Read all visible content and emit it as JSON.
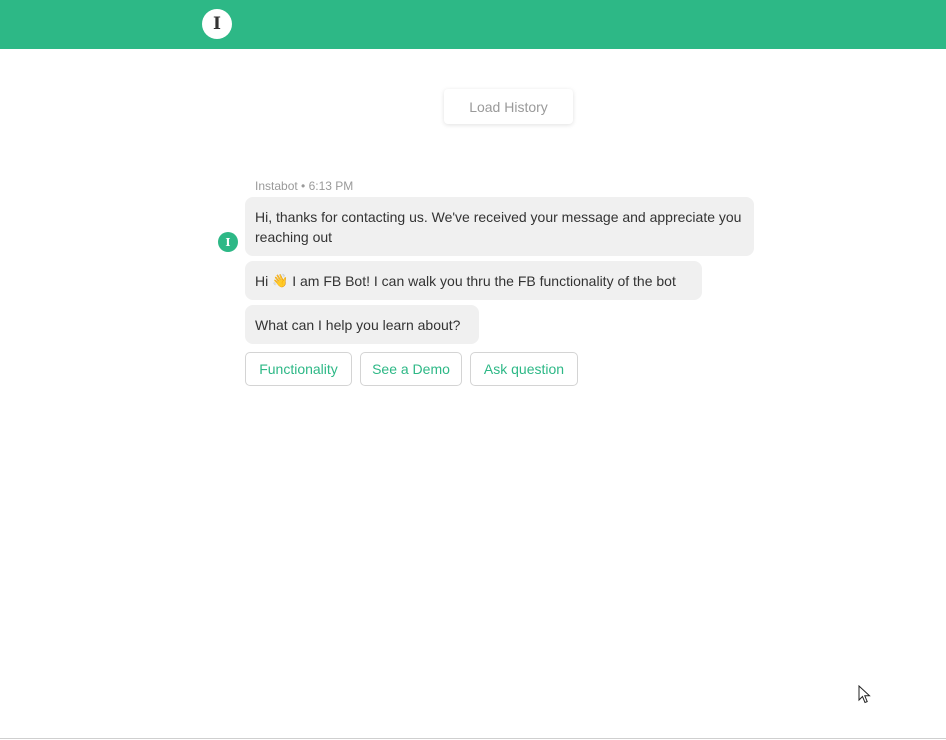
{
  "header": {
    "logo_letter": "I",
    "brand_color": "#2db886"
  },
  "chat": {
    "load_history_label": "Load History",
    "sender_meta": "Instabot • 6:13 PM",
    "bot_avatar_letter": "I",
    "messages": [
      {
        "text": "Hi, thanks for contacting us. We've received your message and appreciate you reaching out"
      },
      {
        "prefix": "Hi ",
        "emoji": "👋",
        "text": " I am FB Bot! I can walk you thru the FB functionality of the bot"
      },
      {
        "text": "What can I help you learn about?"
      }
    ],
    "quick_replies": [
      {
        "label": "Functionality"
      },
      {
        "label": "See a Demo"
      },
      {
        "label": "Ask question"
      }
    ]
  },
  "icons": {
    "logo": "instabot-logo-icon",
    "avatar": "bot-avatar-icon",
    "cursor": "mouse-pointer-icon"
  }
}
